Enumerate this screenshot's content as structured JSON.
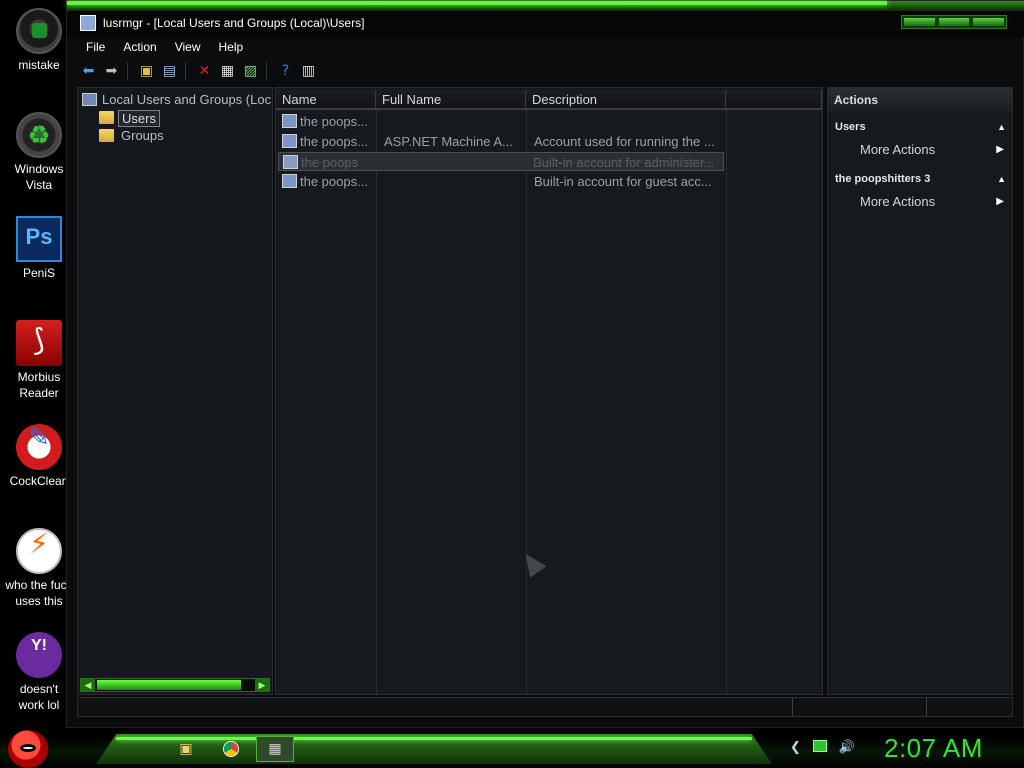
{
  "desktop": {
    "icons": [
      {
        "label": "mistake",
        "icon": "green-circle-icon"
      },
      {
        "label": "Windows Vista",
        "icon": "recycle-bin-icon"
      },
      {
        "label": "PeniS",
        "icon": "photoshop-icon",
        "glyph": "Ps"
      },
      {
        "label": "Morbius Reader",
        "icon": "pdf-reader-icon"
      },
      {
        "label": "CockClean",
        "icon": "ccleaner-icon"
      },
      {
        "label": "who the fuck uses this",
        "icon": "lightning-icon"
      },
      {
        "label": "doesn't work lol",
        "icon": "yahoo-messenger-icon"
      }
    ]
  },
  "window": {
    "title": "lusrmgr - [Local Users and Groups (Local)\\Users]",
    "menu": [
      "File",
      "Action",
      "View",
      "Help"
    ],
    "toolbar": [
      "back-icon",
      "forward-icon",
      "up-folder-icon",
      "show-hide-tree-icon",
      "delete-icon",
      "properties-icon",
      "export-list-icon",
      "help-icon",
      "mmc-icon"
    ]
  },
  "tree": {
    "root": "Local Users and Groups (Loc",
    "children": [
      {
        "label": "Users",
        "selected": true
      },
      {
        "label": "Groups",
        "selected": false
      }
    ]
  },
  "list": {
    "columns": [
      "Name",
      "Full Name",
      "Description",
      ""
    ],
    "rows": [
      {
        "name": "the poops...",
        "full_name": "",
        "description": "",
        "disabled": false
      },
      {
        "name": "the poops...",
        "full_name": "ASP.NET Machine A...",
        "description": "Account used for running the ...",
        "disabled": false
      },
      {
        "name": "the poops",
        "full_name": "",
        "description": "Built-in account for administer...",
        "disabled": true
      },
      {
        "name": "the poops...",
        "full_name": "",
        "description": "Built-in account for guest acc...",
        "disabled": false
      }
    ]
  },
  "actions": {
    "title": "Actions",
    "sections": [
      {
        "header": "Users",
        "items": [
          "More Actions"
        ]
      },
      {
        "header": "the poopshitters 3",
        "items": [
          "More Actions"
        ]
      }
    ]
  },
  "taskbar": {
    "clock": "2:07 AM",
    "apps": [
      "explorer-icon",
      "chrome-icon",
      "lusrmgr-icon"
    ]
  },
  "colors": {
    "accent_green": "#33e233",
    "window_bg": "#16191d"
  }
}
